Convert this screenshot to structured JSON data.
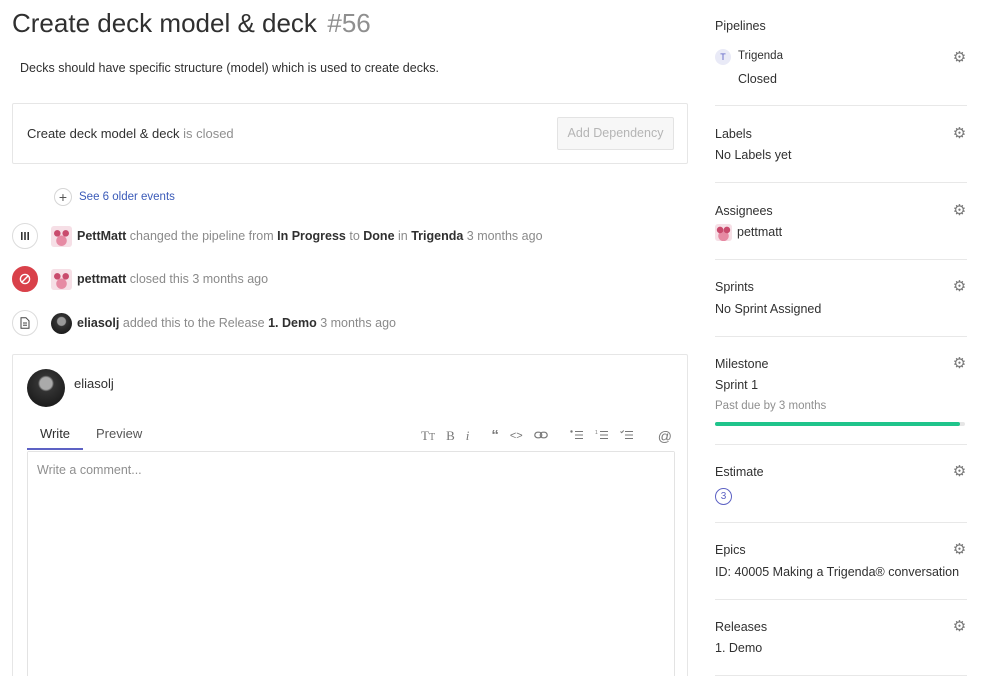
{
  "issue": {
    "title": "Create deck model & deck",
    "number": "#56",
    "description": "Decks should have specific structure (model) which is used to create decks."
  },
  "dependency": {
    "issue_title": "Create deck model & deck",
    "status_text": " is closed",
    "button_label": "Add Dependency"
  },
  "timeline": {
    "older_events_label": "See 6 older events",
    "events": [
      {
        "icon": "pipeline-icon",
        "user": "PettMatt",
        "t1": " changed the pipeline from ",
        "from": "In Progress",
        "t2": " to ",
        "to": "Done",
        "t3": " in ",
        "workspace": "Trigenda",
        "time": " 3 months ago"
      },
      {
        "icon": "closed-icon",
        "user": "pettmatt",
        "text": " closed this 3 months ago"
      },
      {
        "icon": "document-icon",
        "user": "eliasolj",
        "t1": " added this to the Release ",
        "release": "1. Demo",
        "time": " 3 months ago"
      }
    ]
  },
  "comment": {
    "user": "eliasolj",
    "tabs": [
      "Write",
      "Preview"
    ],
    "placeholder": "Write a comment...",
    "toolbar_icons": [
      "text-size-icon",
      "bold-icon",
      "italic-icon",
      "quote-icon",
      "code-icon",
      "link-icon",
      "bullet-list-icon",
      "numbered-list-icon",
      "task-list-icon",
      "mention-icon"
    ]
  },
  "sidebar": {
    "pipelines": {
      "title": "Pipelines",
      "badge": "T",
      "workspace": "Trigenda",
      "status": "Closed"
    },
    "labels": {
      "title": "Labels",
      "value": "No Labels yet"
    },
    "assignees": {
      "title": "Assignees",
      "value": "pettmatt"
    },
    "sprints": {
      "title": "Sprints",
      "value": "No Sprint Assigned"
    },
    "milestone": {
      "title": "Milestone",
      "value": "Sprint 1",
      "due": "Past due by 3 months",
      "progress": 0.98
    },
    "estimate": {
      "title": "Estimate",
      "value": "3"
    },
    "epics": {
      "title": "Epics",
      "value": "ID: 40005  Making a Trigenda® conversation"
    },
    "releases": {
      "title": "Releases",
      "value": "1. Demo"
    }
  },
  "colors": {
    "accent": "#5d62c4",
    "danger": "#d9414a",
    "progress": "#1fc48b",
    "link": "#3a5ab8"
  }
}
